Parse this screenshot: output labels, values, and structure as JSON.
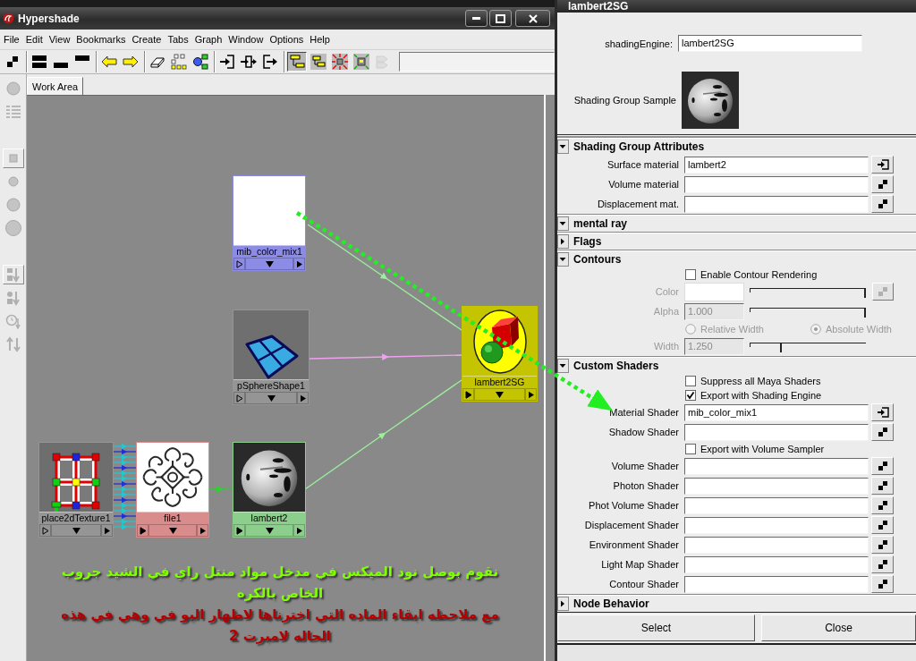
{
  "hypershade": {
    "title": "Hypershade",
    "menu": [
      "File",
      "Edit",
      "View",
      "Bookmarks",
      "Create",
      "Tabs",
      "Graph",
      "Window",
      "Options",
      "Help"
    ],
    "toolbar": [
      {
        "pressed": false,
        "disabled": false
      },
      {
        "pressed": false,
        "disabled": false
      },
      {
        "pressed": false,
        "disabled": false
      },
      {
        "pressed": false,
        "disabled": false
      },
      {
        "pressed": false,
        "disabled": false
      },
      {
        "pressed": false,
        "disabled": false
      },
      {
        "pressed": false,
        "disabled": false
      },
      {
        "pressed": false,
        "disabled": false
      },
      {
        "pressed": false,
        "disabled": false
      },
      {
        "pressed": false,
        "disabled": false
      },
      {
        "pressed": false,
        "disabled": false
      },
      {
        "pressed": false,
        "disabled": false
      },
      {
        "pressed": true,
        "disabled": false
      },
      {
        "pressed": false,
        "disabled": false
      },
      {
        "pressed": false,
        "disabled": false
      },
      {
        "pressed": false,
        "disabled": false
      },
      {
        "pressed": false,
        "disabled": true
      }
    ],
    "side_tools": [
      {
        "selected": false
      },
      {
        "selected": false
      },
      {
        "selected": true
      },
      {
        "selected": false
      },
      {
        "selected": false
      },
      {
        "selected": false
      },
      {
        "selected": true
      },
      {
        "selected": false
      },
      {
        "selected": false
      },
      {
        "selected": false
      }
    ],
    "tabs": [
      {
        "label": "Work Area",
        "selected": true
      }
    ],
    "nodes": [
      {
        "label": "mib_color_mix1",
        "kind": "mentalray",
        "color": "#8c8ce6",
        "input_connected": false
      },
      {
        "label": "pSphereShape1",
        "kind": "shape",
        "color": "#959595",
        "input_connected": false
      },
      {
        "label": "lambert2SG",
        "kind": "shadinggroup",
        "color": "#c4c400",
        "input_connected": true
      },
      {
        "label": "place2dTexture1",
        "kind": "placement",
        "color": "#959595",
        "input_connected": false
      },
      {
        "label": "file1",
        "kind": "texture",
        "color": "#d98c8c",
        "input_connected": true
      },
      {
        "label": "lambert2",
        "kind": "material",
        "color": "#8ccf8c",
        "input_connected": true
      }
    ],
    "annotations": [
      {
        "text": "نقوم بوصل نود الميكس في مدخل مواد منتل راي في الشيد جروب الخاص بالكره",
        "color": "#7fff00"
      },
      {
        "text": "مع ملاحظه ابقاء الماده التي اخترناها لاظهار اليو في وهي في هذه الحاله لامبرت 2",
        "color": "#b40000"
      }
    ]
  },
  "attribute_editor": {
    "title": "lambert2SG",
    "type_label": "shadingEngine:",
    "node_name": "lambert2SG",
    "sample_label": "Shading Group Sample",
    "sections": [
      {
        "title": "Shading Group Attributes",
        "expanded": true,
        "rows": [
          {
            "kind": "field",
            "label": "Surface material",
            "value": "lambert2",
            "connected": true
          },
          {
            "kind": "field",
            "label": "Volume material",
            "connected": false
          },
          {
            "kind": "field",
            "label": "Displacement mat.",
            "connected": false
          }
        ]
      },
      {
        "title": "mental ray",
        "expanded": true,
        "children": [
          {
            "title": "Flags",
            "expanded": false
          },
          {
            "title": "Contours",
            "expanded": true,
            "rows": [
              {
                "kind": "checkbox",
                "label": "Enable Contour Rendering",
                "checked": false,
                "disabled": false
              },
              {
                "kind": "color",
                "label": "Color",
                "color": "#ffffff",
                "level": 1,
                "disabled": true
              },
              {
                "kind": "slider",
                "label": "Alpha",
                "value": "1.000",
                "level": 1,
                "disabled": true
              },
              {
                "kind": "radio",
                "options": [
                  {
                    "label": "Relative Width",
                    "selected": false
                  },
                  {
                    "label": "Absolute Width",
                    "selected": true
                  }
                ],
                "disabled": true
              },
              {
                "kind": "slider",
                "label": "Width",
                "value": "1.250",
                "level": 0.28,
                "disabled": true
              }
            ]
          },
          {
            "title": "Custom Shaders",
            "expanded": true,
            "rows": [
              {
                "kind": "checkbox",
                "label": "Suppress all Maya Shaders",
                "checked": false
              },
              {
                "kind": "checkbox",
                "label": "Export with Shading Engine",
                "checked": true
              },
              {
                "kind": "field",
                "label": "Material Shader",
                "value": "mib_color_mix1",
                "connected": true
              },
              {
                "kind": "field",
                "label": "Shadow Shader",
                "connected": false
              },
              {
                "kind": "checkbox",
                "label": "Export with Volume Sampler",
                "checked": false
              },
              {
                "kind": "field",
                "label": "Volume Shader",
                "connected": false
              },
              {
                "kind": "field",
                "label": "Photon Shader",
                "connected": false
              },
              {
                "kind": "field",
                "label": "Phot Volume Shader",
                "connected": false
              },
              {
                "kind": "field",
                "label": "Displacement Shader",
                "connected": false
              },
              {
                "kind": "field",
                "label": "Environment Shader",
                "connected": false
              },
              {
                "kind": "field",
                "label": "Light Map Shader",
                "connected": false
              },
              {
                "kind": "field",
                "label": "Contour Shader",
                "connected": false
              }
            ]
          }
        ]
      },
      {
        "title": "Node Behavior",
        "expanded": false
      }
    ],
    "buttons": [
      "Select",
      "Close"
    ]
  }
}
